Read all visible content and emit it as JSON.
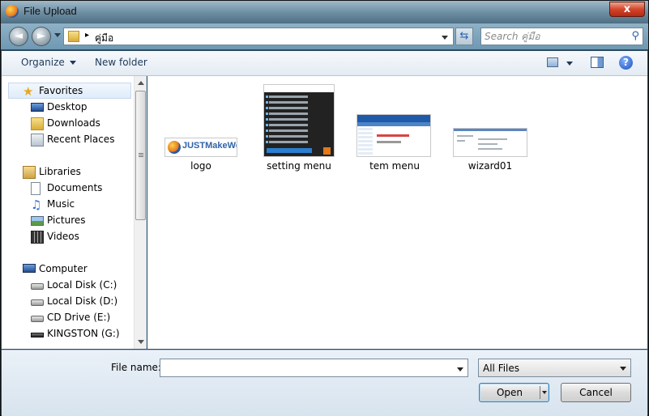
{
  "window": {
    "title": "File Upload",
    "close_label": "x"
  },
  "navbar": {
    "back_label": "◄",
    "forward_label": "►",
    "breadcrumb_separator": "▸",
    "breadcrumb": "คู่มือ",
    "refresh_label": "⇆",
    "search_placeholder": "Search คู่มือ"
  },
  "toolbar": {
    "organize_label": "Organize",
    "new_folder_label": "New folder",
    "help_label": "?"
  },
  "sidebar": {
    "favorites": {
      "label": "Favorites",
      "items": [
        "Desktop",
        "Downloads",
        "Recent Places"
      ]
    },
    "libraries": {
      "label": "Libraries",
      "items": [
        "Documents",
        "Music",
        "Pictures",
        "Videos"
      ]
    },
    "computer": {
      "label": "Computer",
      "items": [
        "Local Disk (C:)",
        "Local Disk (D:)",
        "CD Drive (E:)",
        "KINGSTON (G:)"
      ]
    }
  },
  "files": [
    {
      "name": "logo",
      "thumb_text": "JUSTMakeWeb"
    },
    {
      "name": "setting menu"
    },
    {
      "name": "tem menu"
    },
    {
      "name": "wizard01"
    }
  ],
  "footer": {
    "file_name_label": "File name:",
    "file_name_value": "",
    "filter_value": "All Files",
    "open_label": "Open",
    "cancel_label": "Cancel"
  }
}
